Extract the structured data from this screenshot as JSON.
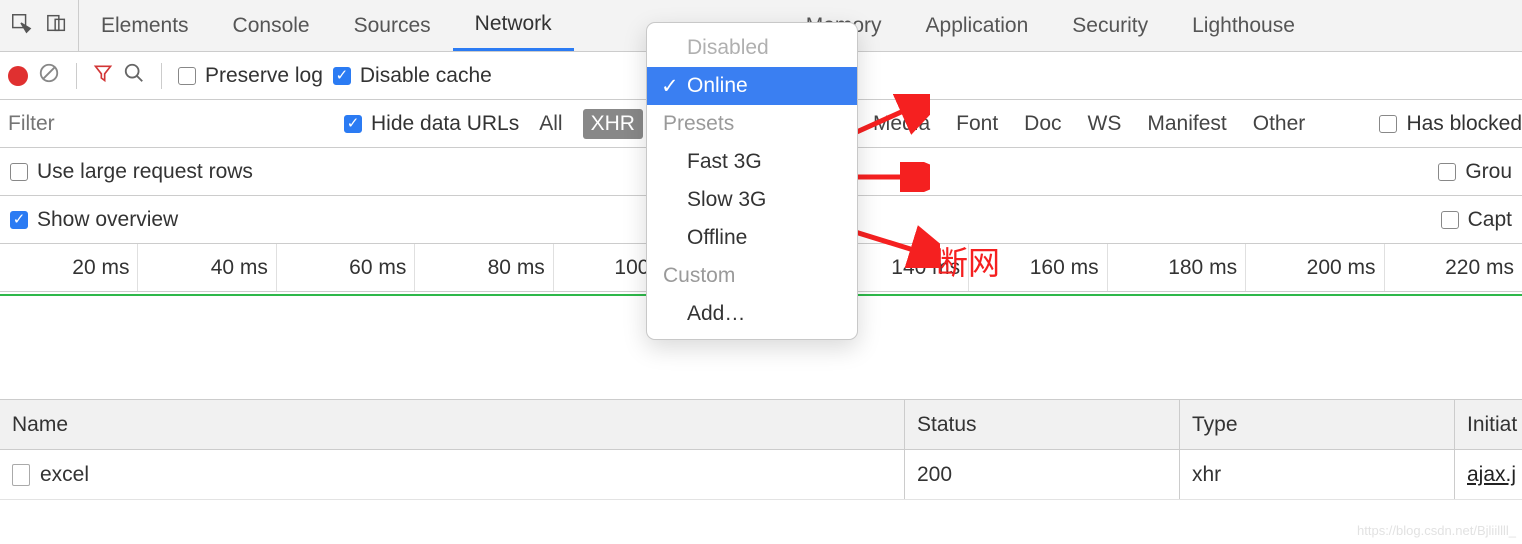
{
  "tabs": {
    "items": [
      "Elements",
      "Console",
      "Sources",
      "Network",
      "",
      "Memory",
      "Application",
      "Security",
      "Lighthouse"
    ],
    "active_index": 3
  },
  "toolbar1": {
    "preserve_log": "Preserve log",
    "disable_cache": "Disable cache"
  },
  "toolbar2": {
    "filter_placeholder": "Filter",
    "hide_data_urls": "Hide data URLs",
    "types": [
      "All",
      "XHR",
      "Media",
      "Font",
      "Doc",
      "WS",
      "Manifest",
      "Other"
    ],
    "selected_type_index": 1,
    "has_blocked": "Has blocked"
  },
  "toolbar3": {
    "large_rows": "Use large request rows",
    "group": "Grou"
  },
  "toolbar4": {
    "show_overview": "Show overview",
    "capture": "Capt"
  },
  "timeline": {
    "ticks": [
      "20 ms",
      "40 ms",
      "60 ms",
      "80 ms",
      "100 ms",
      "",
      "140 ms",
      "160 ms",
      "180 ms",
      "200 ms",
      "220 ms"
    ]
  },
  "dropdown": {
    "disabled": "Disabled",
    "online": "Online",
    "presets_head": "Presets",
    "fast3g": "Fast 3G",
    "slow3g": "Slow 3G",
    "offline": "Offline",
    "custom_head": "Custom",
    "add": "Add…"
  },
  "annotation": "断网",
  "table": {
    "headers": {
      "name": "Name",
      "status": "Status",
      "type": "Type",
      "initiator": "Initiat"
    },
    "row": {
      "name": "excel",
      "status": "200",
      "type": "xhr",
      "initiator": "ajax.j"
    }
  },
  "watermark": "https://blog.csdn.net/Bjliillll_"
}
